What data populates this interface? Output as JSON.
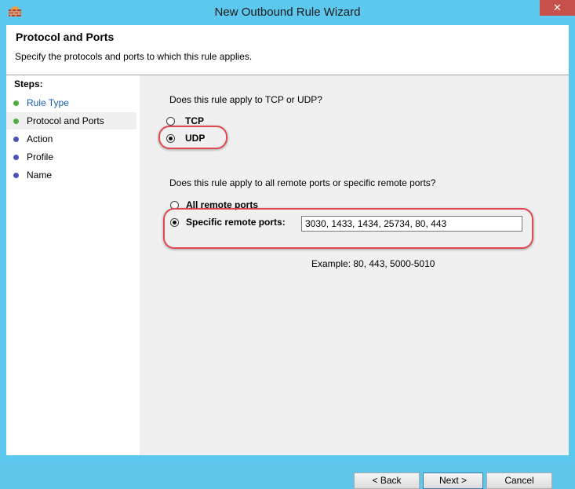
{
  "window": {
    "title": "New Outbound Rule Wizard",
    "close_glyph": "✕"
  },
  "header": {
    "title": "Protocol and Ports",
    "description": "Specify the protocols and ports to which this rule applies."
  },
  "steps": {
    "title": "Steps:",
    "items": [
      {
        "label": "Rule Type",
        "status": "done"
      },
      {
        "label": "Protocol and Ports",
        "status": "current"
      },
      {
        "label": "Action",
        "status": "pending"
      },
      {
        "label": "Profile",
        "status": "pending"
      },
      {
        "label": "Name",
        "status": "pending"
      }
    ]
  },
  "protocol": {
    "question": "Does this rule apply to TCP or UDP?",
    "options": [
      {
        "label": "TCP",
        "checked": false
      },
      {
        "label": "UDP",
        "checked": true
      }
    ]
  },
  "ports": {
    "question": "Does this rule apply to all remote ports or specific remote ports?",
    "all_label": "All remote ports",
    "specific_label": "Specific remote ports:",
    "specific_value": "3030, 1433, 1434, 25734, 80, 443",
    "example": "Example: 80, 443, 5000-5010",
    "selected": "specific"
  },
  "buttons": {
    "back": "< Back",
    "next": "Next >",
    "cancel": "Cancel"
  },
  "colors": {
    "titlebar": "#5cc8ee",
    "close": "#c7504b",
    "step_done": "#4cae3d",
    "step_pending": "#4a55b4",
    "highlight": "#e0484f"
  },
  "icons": {
    "app": "firewall-icon",
    "close": "close-icon"
  }
}
